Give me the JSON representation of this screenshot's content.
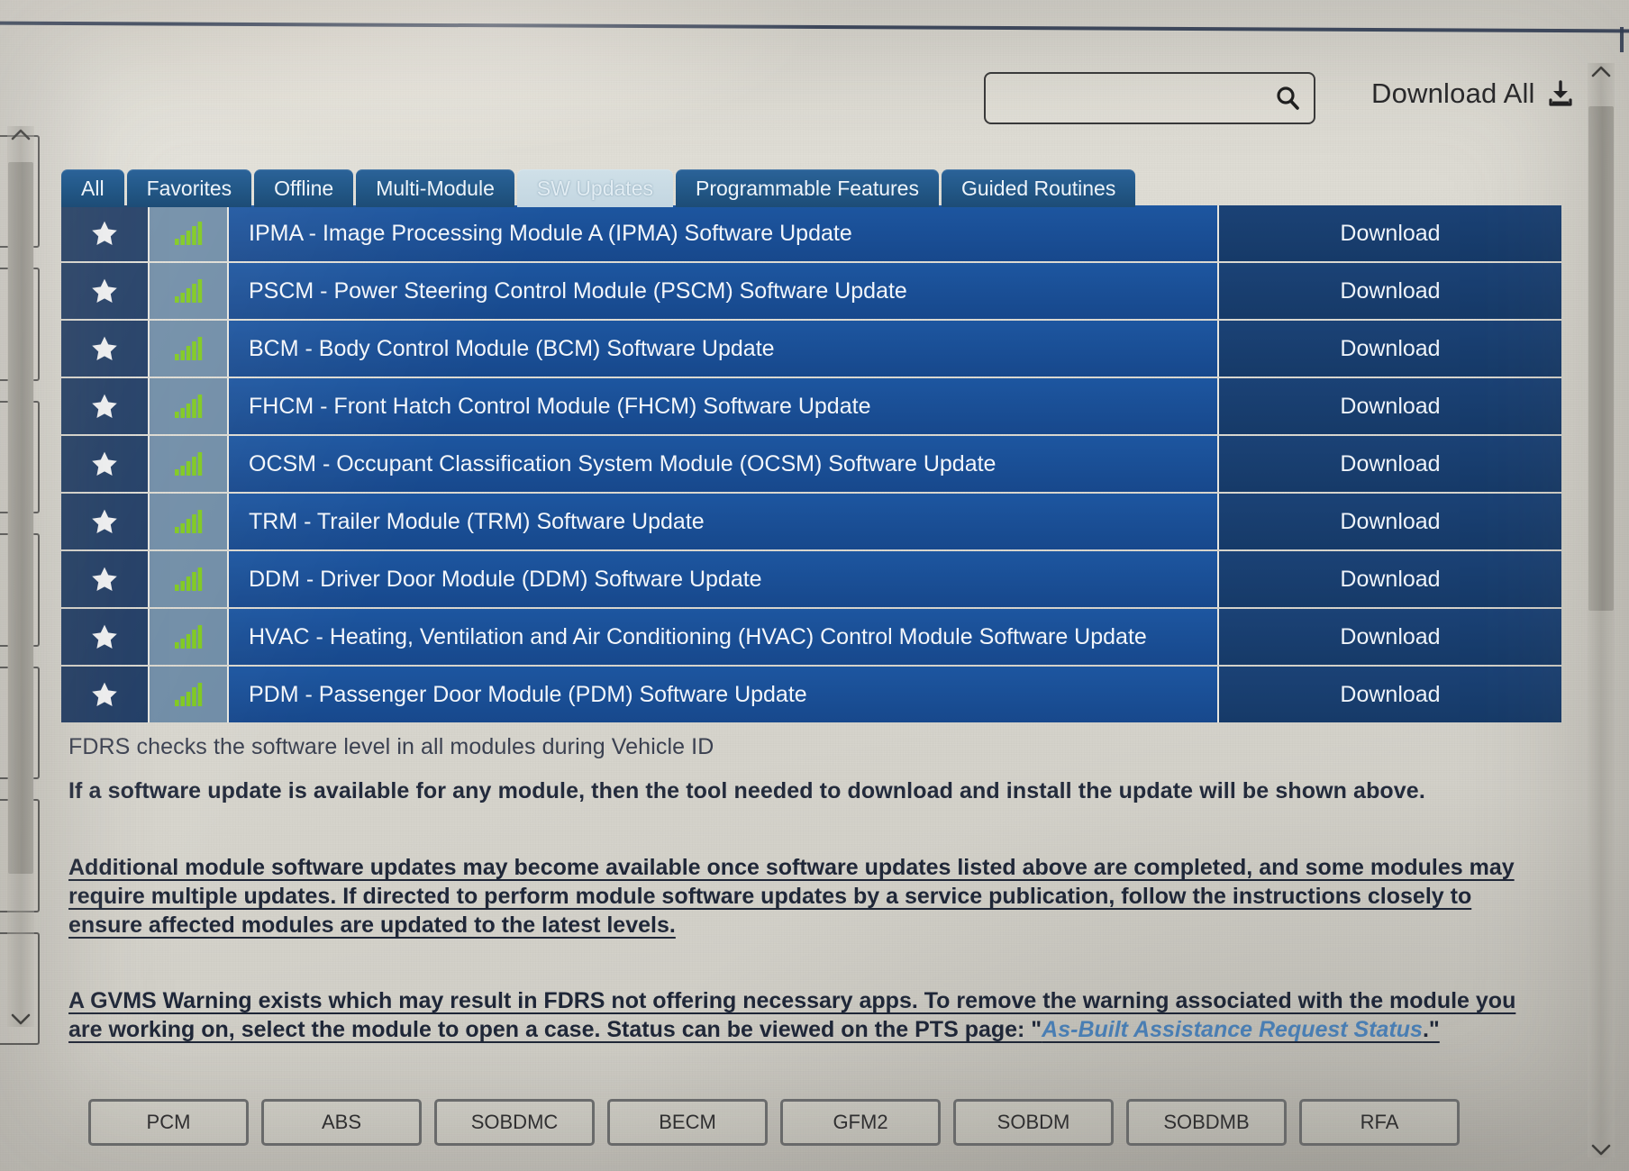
{
  "top_bar": {
    "search": {
      "value": "",
      "placeholder": "",
      "icon": "search-icon"
    },
    "download_all_label": "Download All",
    "download_all_icon": "download-icon"
  },
  "tabs": [
    {
      "label": "All",
      "active": false
    },
    {
      "label": "Favorites",
      "active": false
    },
    {
      "label": "Offline",
      "active": false
    },
    {
      "label": "Multi-Module",
      "active": false
    },
    {
      "label": "SW Updates",
      "active": true
    },
    {
      "label": "Programmable Features",
      "active": false
    },
    {
      "label": "Guided Routines",
      "active": false
    }
  ],
  "table": {
    "action_label": "Download",
    "favorite_icon": "star-icon",
    "signal_icon": "signal-bars-icon",
    "rows": [
      {
        "title": "IPMA - Image Processing Module A (IPMA) Software Update",
        "action": "Download"
      },
      {
        "title": "PSCM - Power Steering Control Module (PSCM) Software Update",
        "action": "Download"
      },
      {
        "title": "BCM - Body Control Module (BCM) Software Update",
        "action": "Download"
      },
      {
        "title": "FHCM - Front Hatch Control Module (FHCM) Software Update",
        "action": "Download"
      },
      {
        "title": "OCSM - Occupant Classification System Module (OCSM) Software Update",
        "action": "Download"
      },
      {
        "title": "TRM - Trailer Module (TRM) Software Update",
        "action": "Download"
      },
      {
        "title": "DDM - Driver Door Module (DDM) Software Update",
        "action": "Download"
      },
      {
        "title": "HVAC - Heating, Ventilation and Air Conditioning (HVAC) Control Module Software Update",
        "action": "Download"
      },
      {
        "title": "PDM - Passenger Door Module (PDM) Software Update",
        "action": "Download"
      }
    ]
  },
  "info": {
    "line1": "FDRS checks the software level in all modules during Vehicle ID",
    "line2": "If a software update is available for any module, then the tool needed to download and install the update will be shown above.",
    "para1": "Additional module software updates may become available once software updates listed above are completed, and some modules may require multiple updates. If directed to perform module software updates by a service publication, follow the instructions closely to ensure affected modules are updated to the latest levels.",
    "para2_part1": "A GVMS Warning exists which may result in FDRS not offering necessary apps. To remove the warning associated with the module you are working on, select the module to open a case. Status can be viewed on the PTS page: \"",
    "para2_link": "As-Built Assistance Request Status",
    "para2_part2": ".\""
  },
  "module_buttons": [
    {
      "label": "PCM"
    },
    {
      "label": "ABS"
    },
    {
      "label": "SOBDMC"
    },
    {
      "label": "BECM"
    },
    {
      "label": "GFM2"
    },
    {
      "label": "SOBDM"
    },
    {
      "label": "SOBDMB"
    },
    {
      "label": "RFA"
    }
  ],
  "colors": {
    "tab_inactive": "#225786",
    "tab_active": "#c3d6e1",
    "row_title_bg": "#17488c",
    "row_action_bg": "#163a68",
    "favorite_cell_bg": "#1d3a63",
    "signal_cell_bg": "#6f8ca6",
    "signal_bar": "#7ec81e",
    "link_text": "#4a7fb5",
    "page_bg": "#dedcd4"
  }
}
